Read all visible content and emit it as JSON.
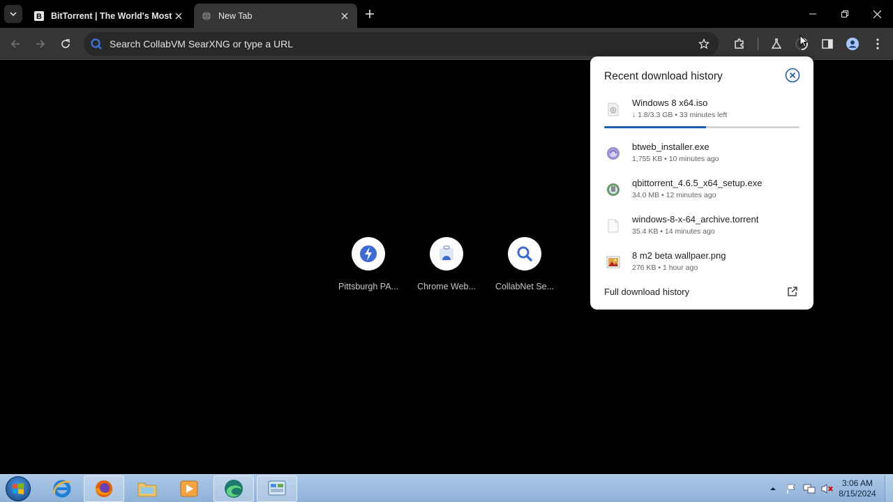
{
  "browser": {
    "tabs": [
      {
        "title": "BitTorrent | The World's Most I",
        "active": false,
        "favicon_letter": "B"
      },
      {
        "title": "New Tab",
        "active": true
      }
    ],
    "omnibox_placeholder": "Search CollabVM SearXNG or type a URL"
  },
  "ntp": {
    "shortcuts": [
      {
        "label": "Pittsburgh PA...",
        "icon": "pittsburgh-icon"
      },
      {
        "label": "Chrome Web...",
        "icon": "chrome-web-store-icon"
      },
      {
        "label": "CollabNet Se...",
        "icon": "search-icon"
      }
    ]
  },
  "downloads": {
    "title": "Recent download history",
    "items": [
      {
        "name": "Windows 8 x64.iso",
        "meta": "↓ 1.8/3.3 GB • 33 minutes left",
        "progress": 0.52,
        "icon": "iso-file-icon"
      },
      {
        "name": "btweb_installer.exe",
        "meta": "1,755 KB • 10 minutes ago",
        "icon": "btweb-installer-icon"
      },
      {
        "name": "qbittorrent_4.6.5_x64_setup.exe",
        "meta": "34.0 MB • 12 minutes ago",
        "icon": "qbittorrent-installer-icon"
      },
      {
        "name": "windows-8-x-64_archive.torrent",
        "meta": "35.4 KB • 14 minutes ago",
        "icon": "torrent-file-icon"
      },
      {
        "name": "8 m2 beta wallpaer.png",
        "meta": "276 KB • 1 hour ago",
        "icon": "image-file-icon"
      }
    ],
    "full_history_label": "Full download history"
  },
  "taskbar": {
    "time": "3:06 AM",
    "date": "8/15/2024",
    "apps": [
      "internet-explorer",
      "firefox",
      "file-explorer",
      "media-player",
      "edge",
      "control-panel"
    ]
  },
  "colors": {
    "accent": "#1a5fb4",
    "toolbar": "#353535",
    "background": "#000000"
  }
}
